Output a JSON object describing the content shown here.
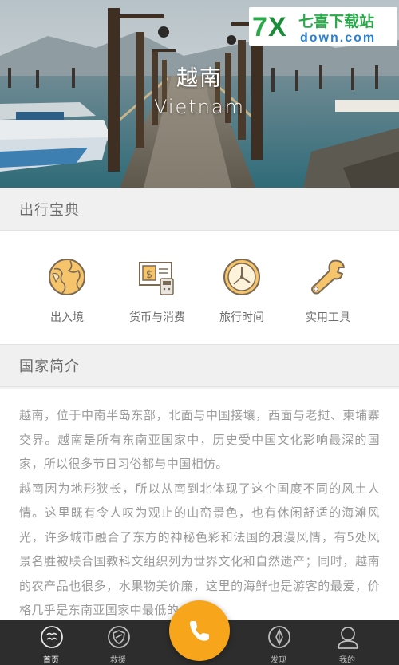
{
  "hero": {
    "title": "越南",
    "subtitle": "Vietnam"
  },
  "watermark": {
    "logo_text": "7X",
    "brand_cn": "七喜下载站",
    "brand_url": "down.com"
  },
  "guide_section": {
    "title": "出行宝典",
    "tools": [
      {
        "label": "出入境",
        "icon": "globe-icon"
      },
      {
        "label": "货币与消费",
        "icon": "currency-icon"
      },
      {
        "label": "旅行时间",
        "icon": "clock-icon"
      },
      {
        "label": "实用工具",
        "icon": "wrench-icon"
      }
    ]
  },
  "country_section": {
    "title": "国家简介",
    "paragraph_1": "越南，位于中南半岛东部，北面与中国接壤，西面与老挝、柬埔寨交界。越南是所有东南亚国家中，历史受中国文化影响最深的国家，所以很多节日习俗都与中国相仿。",
    "paragraph_2": "越南因为地形狭长，所以从南到北体现了这个国度不同的风土人情。这里既有令人叹为观止的山峦景色，也有休闲舒适的海滩风光，许多城市融合了东方的神秘色彩和法国的浪漫风情，有5处风景名胜被联合国教科文组织列为世界文化和自然遗产；同时，越南的农产品也很多，水果物美价廉，这里的海鲜也是游客的最爱，价格几乎是东南亚国家中最低的。"
  },
  "tabbar": {
    "tabs": [
      {
        "label": "首页",
        "icon": "home-icon"
      },
      {
        "label": "救援",
        "icon": "shield-icon"
      },
      {
        "label": "发现",
        "icon": "compass-icon"
      },
      {
        "label": "我的",
        "icon": "user-icon"
      }
    ],
    "call_icon": "phone-icon"
  },
  "colors": {
    "accent": "#f7a51b",
    "icon_fill": "#f6c46a",
    "icon_stroke": "#7a6a55",
    "tabbar_bg": "#2d2d2d",
    "body_text": "#9a9a9a"
  }
}
